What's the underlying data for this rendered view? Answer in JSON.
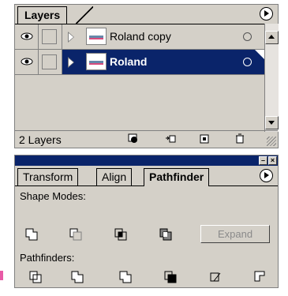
{
  "layers_panel": {
    "tab_label": "Layers",
    "layers": [
      {
        "name": "Roland copy",
        "selected": false
      },
      {
        "name": "Roland",
        "selected": true
      }
    ],
    "footer_text": "2 Layers"
  },
  "pathfinder_panel": {
    "tabs": [
      "Transform",
      "Align",
      "Pathfinder"
    ],
    "active_tab": "Pathfinder",
    "shape_modes_label": "Shape Modes:",
    "expand_label": "Expand",
    "pathfinders_label": "Pathfinders:"
  },
  "colors": {
    "selection": "#0a246a",
    "panel": "#d4d0c8"
  }
}
